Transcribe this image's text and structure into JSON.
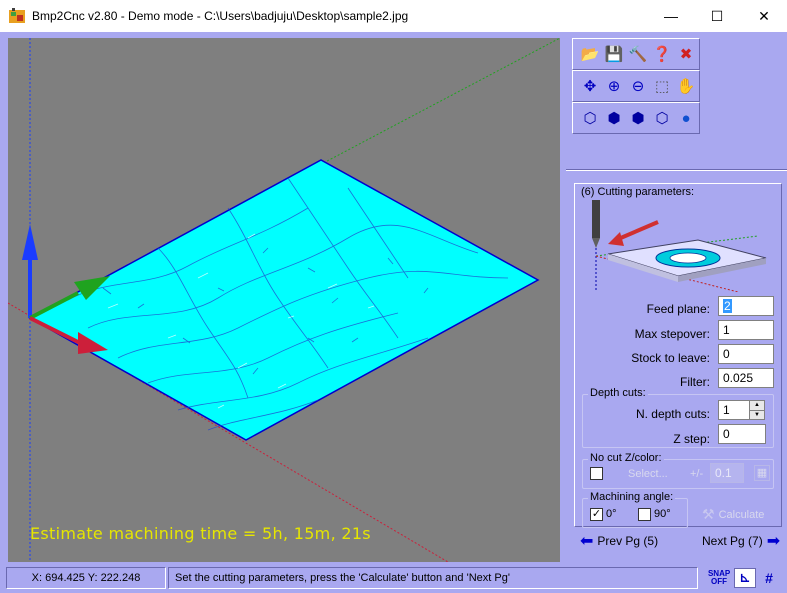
{
  "window": {
    "title": "Bmp2Cnc v2.80 - Demo mode - C:\\Users\\badjuju\\Desktop\\sample2.jpg",
    "minimize": "—",
    "maximize": "☐",
    "close": "✕"
  },
  "toolbar": {
    "row1": [
      {
        "name": "open-folder-icon",
        "glyph": "📂"
      },
      {
        "name": "save-disk-icon",
        "glyph": "💾"
      },
      {
        "name": "hammer-icon",
        "glyph": "🔨"
      },
      {
        "name": "help-icon",
        "glyph": "❓"
      },
      {
        "name": "close-red-icon",
        "glyph": "✖"
      }
    ],
    "row2": [
      {
        "name": "move-arrows-icon",
        "glyph": "✥"
      },
      {
        "name": "zoom-in-icon",
        "glyph": "🔍"
      },
      {
        "name": "zoom-out-icon",
        "glyph": "🔎"
      },
      {
        "name": "zoom-fit-icon",
        "glyph": "⬚"
      },
      {
        "name": "pan-hand-icon",
        "glyph": "✋"
      }
    ],
    "row3": [
      {
        "name": "view-iso-icon",
        "glyph": "⬡"
      },
      {
        "name": "view-front-icon",
        "glyph": "⬢"
      },
      {
        "name": "view-side-icon",
        "glyph": "⬢"
      },
      {
        "name": "view-wire-icon",
        "glyph": "⬡"
      },
      {
        "name": "view-sphere-icon",
        "glyph": "●"
      }
    ]
  },
  "viewport": {
    "estimate": "Estimate machining time = 5h, 15m, 21s",
    "colors": {
      "background": "#7f7f7f",
      "surface": "#00ffff",
      "mesh": "#0000cc",
      "axis_z": "#1a3cff",
      "axis_y": "#1fa31f",
      "axis_x": "#cc1f3a"
    }
  },
  "params": {
    "title": "(6) Cutting parameters:",
    "feed_plane_label": "Feed plane:",
    "feed_plane_value": "2",
    "max_stepover_label": "Max stepover:",
    "max_stepover_value": "1",
    "stock_label": "Stock to leave:",
    "stock_value": "0",
    "filter_label": "Filter:",
    "filter_value": "0.025",
    "depth_group": "Depth cuts:",
    "n_depth_label": "N. depth cuts:",
    "n_depth_value": "1",
    "z_step_label": "Z step:",
    "z_step_value": "0",
    "nocut_group": "No cut Z/color:",
    "select_label": "Select...",
    "plus_minus": "+/-",
    "nocut_value": "0.1",
    "angle_group": "Machining angle:",
    "angle_0": "0°",
    "angle_90": "90°",
    "angle_0_checked": "✓",
    "calculate_label": "Calculate",
    "prev_label": "Prev Pg (5)",
    "next_label": "Next Pg (7)"
  },
  "status": {
    "coords": "X: 694.425 Y: 222.248",
    "message": "Set the cutting parameters, press the 'Calculate' button and 'Next Pg'",
    "snap_label": "SNAP OFF"
  }
}
